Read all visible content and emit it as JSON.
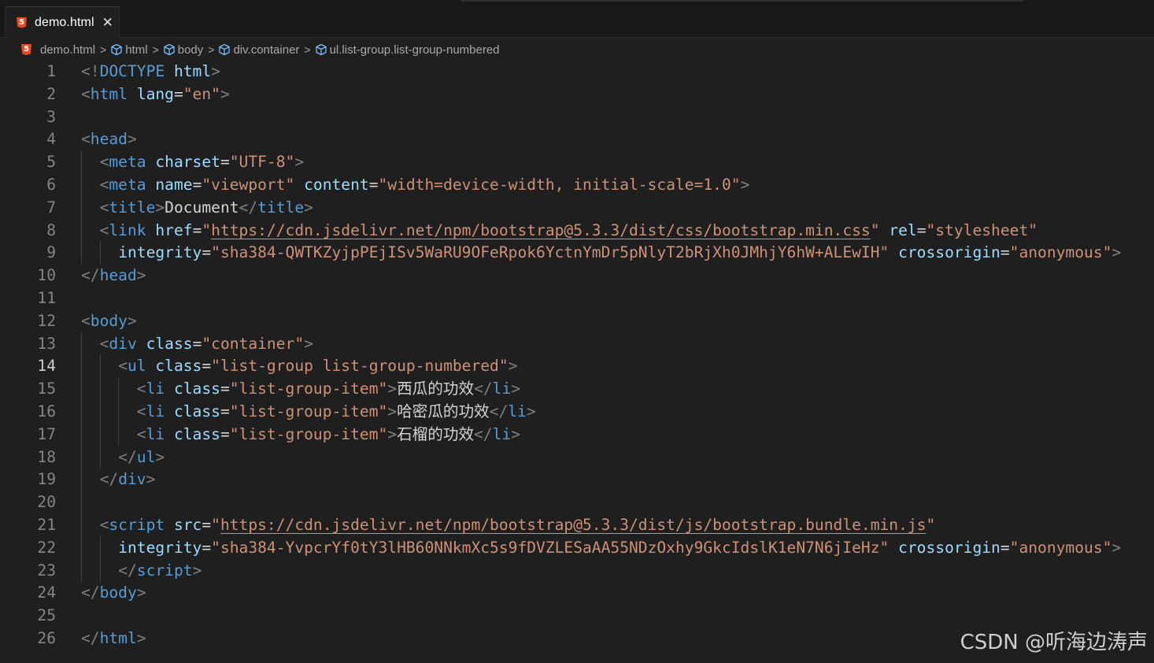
{
  "tab": {
    "label": "demo.html",
    "close": "✕",
    "icon": "html5-icon"
  },
  "breadcrumb": {
    "items": [
      "demo.html",
      "html",
      "body",
      "div.container",
      "ul.list-group.list-group-numbered"
    ],
    "separator": ">"
  },
  "editor": {
    "active_line": 14,
    "line_numbers": [
      "1",
      "2",
      "3",
      "4",
      "5",
      "6",
      "7",
      "8",
      "9",
      "10",
      "11",
      "12",
      "13",
      "14",
      "15",
      "16",
      "17",
      "18",
      "19",
      "20",
      "21",
      "22",
      "23",
      "24",
      "25",
      "26"
    ],
    "lines": [
      [
        [
          "p",
          "<!"
        ],
        [
          "t",
          "DOCTYPE"
        ],
        [
          "x",
          " "
        ],
        [
          "a",
          "html"
        ],
        [
          "p",
          ">"
        ]
      ],
      [
        [
          "p",
          "<"
        ],
        [
          "t",
          "html"
        ],
        [
          "x",
          " "
        ],
        [
          "a",
          "lang"
        ],
        [
          "x",
          "="
        ],
        [
          "s",
          "\"en\""
        ],
        [
          "p",
          ">"
        ]
      ],
      [],
      [
        [
          "p",
          "<"
        ],
        [
          "t",
          "head"
        ],
        [
          "p",
          ">"
        ]
      ],
      [
        [
          "x",
          "  "
        ],
        [
          "p",
          "<"
        ],
        [
          "t",
          "meta"
        ],
        [
          "x",
          " "
        ],
        [
          "a",
          "charset"
        ],
        [
          "x",
          "="
        ],
        [
          "s",
          "\"UTF-8\""
        ],
        [
          "p",
          ">"
        ]
      ],
      [
        [
          "x",
          "  "
        ],
        [
          "p",
          "<"
        ],
        [
          "t",
          "meta"
        ],
        [
          "x",
          " "
        ],
        [
          "a",
          "name"
        ],
        [
          "x",
          "="
        ],
        [
          "s",
          "\"viewport\""
        ],
        [
          "x",
          " "
        ],
        [
          "a",
          "content"
        ],
        [
          "x",
          "="
        ],
        [
          "s",
          "\"width=device-width, initial-scale=1.0\""
        ],
        [
          "p",
          ">"
        ]
      ],
      [
        [
          "x",
          "  "
        ],
        [
          "p",
          "<"
        ],
        [
          "t",
          "title"
        ],
        [
          "p",
          ">"
        ],
        [
          "x",
          "Document"
        ],
        [
          "p",
          "</"
        ],
        [
          "t",
          "title"
        ],
        [
          "p",
          ">"
        ]
      ],
      [
        [
          "x",
          "  "
        ],
        [
          "p",
          "<"
        ],
        [
          "t",
          "link"
        ],
        [
          "x",
          " "
        ],
        [
          "a",
          "href"
        ],
        [
          "x",
          "="
        ],
        [
          "s",
          "\""
        ],
        [
          "su",
          "https://cdn.jsdelivr.net/npm/bootstrap@5.3.3/dist/css/bootstrap.min.css"
        ],
        [
          "s",
          "\""
        ],
        [
          "x",
          " "
        ],
        [
          "a",
          "rel"
        ],
        [
          "x",
          "="
        ],
        [
          "s",
          "\"stylesheet\""
        ]
      ],
      [
        [
          "x",
          "    "
        ],
        [
          "a",
          "integrity"
        ],
        [
          "x",
          "="
        ],
        [
          "s",
          "\"sha384-QWTKZyjpPEjISv5WaRU9OFeRpok6YctnYmDr5pNlyT2bRjXh0JMhjY6hW+ALEwIH\""
        ],
        [
          "x",
          " "
        ],
        [
          "a",
          "crossorigin"
        ],
        [
          "x",
          "="
        ],
        [
          "s",
          "\"anonymous\""
        ],
        [
          "p",
          ">"
        ]
      ],
      [
        [
          "p",
          "</"
        ],
        [
          "t",
          "head"
        ],
        [
          "p",
          ">"
        ]
      ],
      [],
      [
        [
          "p",
          "<"
        ],
        [
          "t",
          "body"
        ],
        [
          "p",
          ">"
        ]
      ],
      [
        [
          "x",
          "  "
        ],
        [
          "p",
          "<"
        ],
        [
          "t",
          "div"
        ],
        [
          "x",
          " "
        ],
        [
          "a",
          "class"
        ],
        [
          "x",
          "="
        ],
        [
          "s",
          "\"container\""
        ],
        [
          "p",
          ">"
        ]
      ],
      [
        [
          "x",
          "    "
        ],
        [
          "p",
          "<"
        ],
        [
          "t",
          "ul"
        ],
        [
          "x",
          " "
        ],
        [
          "a",
          "class"
        ],
        [
          "x",
          "="
        ],
        [
          "s",
          "\"list-group list-group-numbered\""
        ],
        [
          "p",
          ">"
        ]
      ],
      [
        [
          "x",
          "      "
        ],
        [
          "p",
          "<"
        ],
        [
          "t",
          "li"
        ],
        [
          "x",
          " "
        ],
        [
          "a",
          "class"
        ],
        [
          "x",
          "="
        ],
        [
          "s",
          "\"list-group-item\""
        ],
        [
          "p",
          ">"
        ],
        [
          "c",
          "西瓜的功效"
        ],
        [
          "p",
          "</"
        ],
        [
          "t",
          "li"
        ],
        [
          "p",
          ">"
        ]
      ],
      [
        [
          "x",
          "      "
        ],
        [
          "p",
          "<"
        ],
        [
          "t",
          "li"
        ],
        [
          "x",
          " "
        ],
        [
          "a",
          "class"
        ],
        [
          "x",
          "="
        ],
        [
          "s",
          "\"list-group-item\""
        ],
        [
          "p",
          ">"
        ],
        [
          "c",
          "哈密瓜的功效"
        ],
        [
          "p",
          "</"
        ],
        [
          "t",
          "li"
        ],
        [
          "p",
          ">"
        ]
      ],
      [
        [
          "x",
          "      "
        ],
        [
          "p",
          "<"
        ],
        [
          "t",
          "li"
        ],
        [
          "x",
          " "
        ],
        [
          "a",
          "class"
        ],
        [
          "x",
          "="
        ],
        [
          "s",
          "\"list-group-item\""
        ],
        [
          "p",
          ">"
        ],
        [
          "c",
          "石榴的功效"
        ],
        [
          "p",
          "</"
        ],
        [
          "t",
          "li"
        ],
        [
          "p",
          ">"
        ]
      ],
      [
        [
          "x",
          "    "
        ],
        [
          "p",
          "</"
        ],
        [
          "t",
          "ul"
        ],
        [
          "p",
          ">"
        ]
      ],
      [
        [
          "x",
          "  "
        ],
        [
          "p",
          "</"
        ],
        [
          "t",
          "div"
        ],
        [
          "p",
          ">"
        ]
      ],
      [],
      [
        [
          "x",
          "  "
        ],
        [
          "p",
          "<"
        ],
        [
          "t",
          "script"
        ],
        [
          "x",
          " "
        ],
        [
          "a",
          "src"
        ],
        [
          "x",
          "="
        ],
        [
          "s",
          "\""
        ],
        [
          "su",
          "https://cdn.jsdelivr.net/npm/bootstrap@5.3.3/dist/js/bootstrap.bundle.min.js"
        ],
        [
          "s",
          "\""
        ]
      ],
      [
        [
          "x",
          "    "
        ],
        [
          "a",
          "integrity"
        ],
        [
          "x",
          "="
        ],
        [
          "s",
          "\"sha384-YvpcrYf0tY3lHB60NNkmXc5s9fDVZLESaAA55NDzOxhy9GkcIdslK1eN7N6jIeHz\""
        ],
        [
          "x",
          " "
        ],
        [
          "a",
          "crossorigin"
        ],
        [
          "x",
          "="
        ],
        [
          "s",
          "\"anonymous\""
        ],
        [
          "p",
          ">"
        ]
      ],
      [
        [
          "x",
          "    "
        ],
        [
          "p",
          "</"
        ],
        [
          "t",
          "script"
        ],
        [
          "p",
          ">"
        ]
      ],
      [
        [
          "p",
          "</"
        ],
        [
          "t",
          "body"
        ],
        [
          "p",
          ">"
        ]
      ],
      [],
      [
        [
          "p",
          "</"
        ],
        [
          "t",
          "html"
        ],
        [
          "p",
          ">"
        ]
      ]
    ],
    "indent_guides": [
      [],
      [],
      [],
      [],
      [
        0
      ],
      [
        0
      ],
      [
        0
      ],
      [
        0
      ],
      [
        0,
        1
      ],
      [],
      [],
      [],
      [
        0
      ],
      [
        0,
        1
      ],
      [
        0,
        1,
        2
      ],
      [
        0,
        1,
        2
      ],
      [
        0,
        1,
        2
      ],
      [
        0,
        1
      ],
      [
        0
      ],
      [
        0
      ],
      [
        0
      ],
      [
        0,
        1
      ],
      [
        0,
        1
      ],
      [],
      [],
      []
    ]
  },
  "watermark": "CSDN @听海边涛声"
}
